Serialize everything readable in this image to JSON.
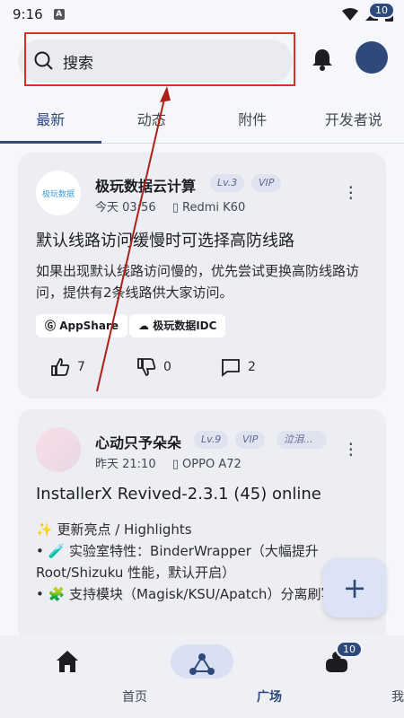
{
  "status": {
    "time": "9:16",
    "a": "A"
  },
  "header": {
    "search_placeholder": "搜索",
    "avatar_badge": "10"
  },
  "tabs": [
    "最新",
    "动态",
    "附件",
    "开发者说"
  ],
  "posts": [
    {
      "author": "极玩数据云计算",
      "logo_text": "极玩数据",
      "level": "Lv.3",
      "vip": "VIP",
      "time": "今天 03:56",
      "device": "Redmi K60",
      "title": "默认线路访问缓慢时可选择高防线路",
      "body": "如果出现默认线路访问慢的，优先尝试更换高防线路访问，提供有2条线路供大家访问。",
      "chips": [
        "AppShare",
        "极玩数据IDC"
      ],
      "likes": "7",
      "dislikes": "0",
      "comments": "2"
    },
    {
      "author": "心动只予朵朵",
      "level": "Lv.9",
      "vip": "VIP",
      "extra_tag": "泣泪...",
      "time": "昨天 21:10",
      "device": "OPPO A72",
      "title": "InstallerX Revived-2.3.1 (45) online",
      "line1": "✨ 更新亮点 / Highlights",
      "line2": "• 🧪 实验室特性：BinderWrapper（大幅提升Root/Shizuku 性能，默认开启）",
      "line3": "• 🧩 支持模块（Magisk/KSU/Apatch）分离刷写..."
    }
  ],
  "fab": "+",
  "bottom_nav": [
    {
      "label": "首页",
      "icon": "home-icon"
    },
    {
      "label": "广场",
      "icon": "square-icon"
    },
    {
      "label": "我的",
      "icon": "profile-icon"
    }
  ],
  "nav_badge": "10",
  "colors": {
    "accent": "#2f4a7a",
    "highlight": "#d93025"
  }
}
